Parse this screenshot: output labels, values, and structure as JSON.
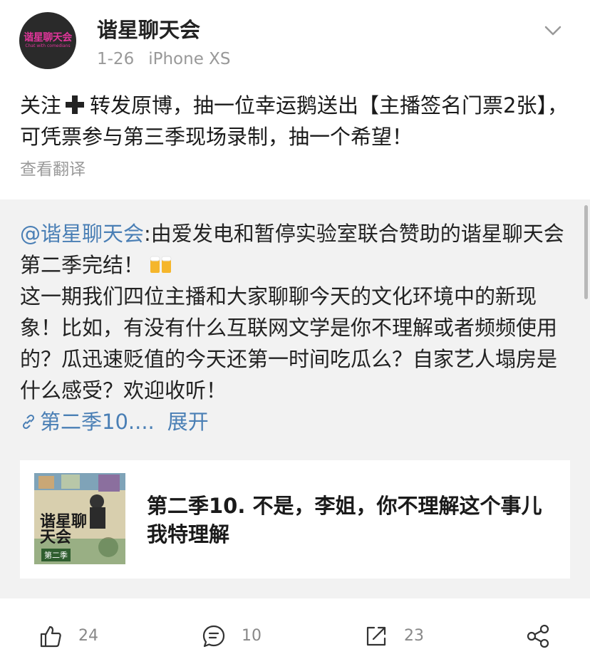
{
  "post": {
    "avatar_label": "谐星聊天会",
    "avatar_sub": "Chat with comedians",
    "username": "谐星聊天会",
    "date": "1-26",
    "device": "iPhone XS",
    "text_before_icon": "关注",
    "text_after_icon": "转发原博，抽一位幸运鹅送出【主播签名门票2张】，可凭票参与第三季现场录制，抽一个希望！",
    "translate_label": "查看翻译"
  },
  "repost": {
    "mention": "@谐星聊天会",
    "text_first": ":由爱发电和暂停实验室联合赞助的谐星聊天会第二季完结！",
    "text_second": "这一期我们四位主播和大家聊聊今天的文化环境中的新现象！比如，有没有什么互联网文学是你不理解或者频频使用的？瓜迅速贬值的今天还第一时间吃瓜么？自家艺人塌房是什么感受？欢迎收听！",
    "link_label": "第二季10....",
    "expand_label": "展开",
    "card": {
      "thumb_title": "谐星聊天会",
      "thumb_badge": "第二季",
      "title": "第二季10. 不是，李姐，你不理解这个事儿我特理解"
    }
  },
  "actions": {
    "like_count": "24",
    "comment_count": "10",
    "repost_count": "23"
  },
  "colors": {
    "link": "#4a7fb5",
    "muted": "#999999",
    "repost_bg": "#f2f2f2",
    "avatar_accent": "#e0359a"
  },
  "icons": [
    "chevron-down-icon",
    "plus-icon",
    "beer-icon",
    "link-icon",
    "like-icon",
    "comment-icon",
    "repost-icon",
    "share-icon"
  ]
}
